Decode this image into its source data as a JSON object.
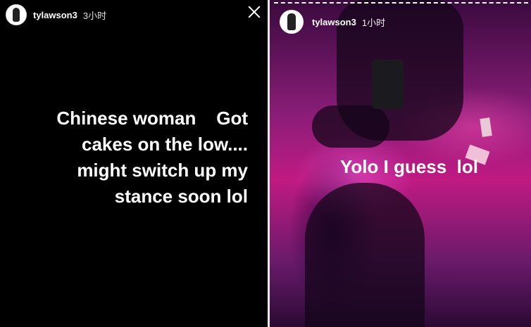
{
  "left_story": {
    "username": "tylawson3",
    "timestamp": "3小时",
    "caption_lines": [
      "Chinese woman    Got",
      "cakes on the low....",
      "might switch up my",
      "stance soon lol"
    ],
    "avatar_icon": "avatar-icon",
    "close_icon": "close-icon"
  },
  "right_story": {
    "username": "tylawson3",
    "timestamp": "1小时",
    "caption": "Yolo I guess  lol",
    "avatar_icon": "avatar-icon"
  },
  "colors": {
    "left_background": "#000000",
    "right_accent": "#c01a83",
    "text": "#ffffff"
  }
}
